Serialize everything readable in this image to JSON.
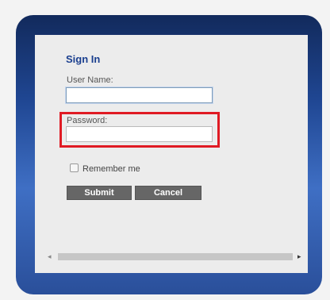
{
  "login": {
    "title": "Sign In",
    "username_label": "User Name:",
    "username_value": "",
    "password_label": "Password:",
    "password_value": "",
    "remember_label": "Remember me",
    "remember_checked": false,
    "submit_label": "Submit",
    "cancel_label": "Cancel"
  },
  "scrollbar": {
    "left_arrow": "◂",
    "right_arrow": "▸"
  },
  "colors": {
    "frame_top": "#122a5c",
    "frame_mid": "#3f6fc4",
    "title": "#1a3f8f",
    "highlight": "#e01b24",
    "button": "#666666"
  }
}
